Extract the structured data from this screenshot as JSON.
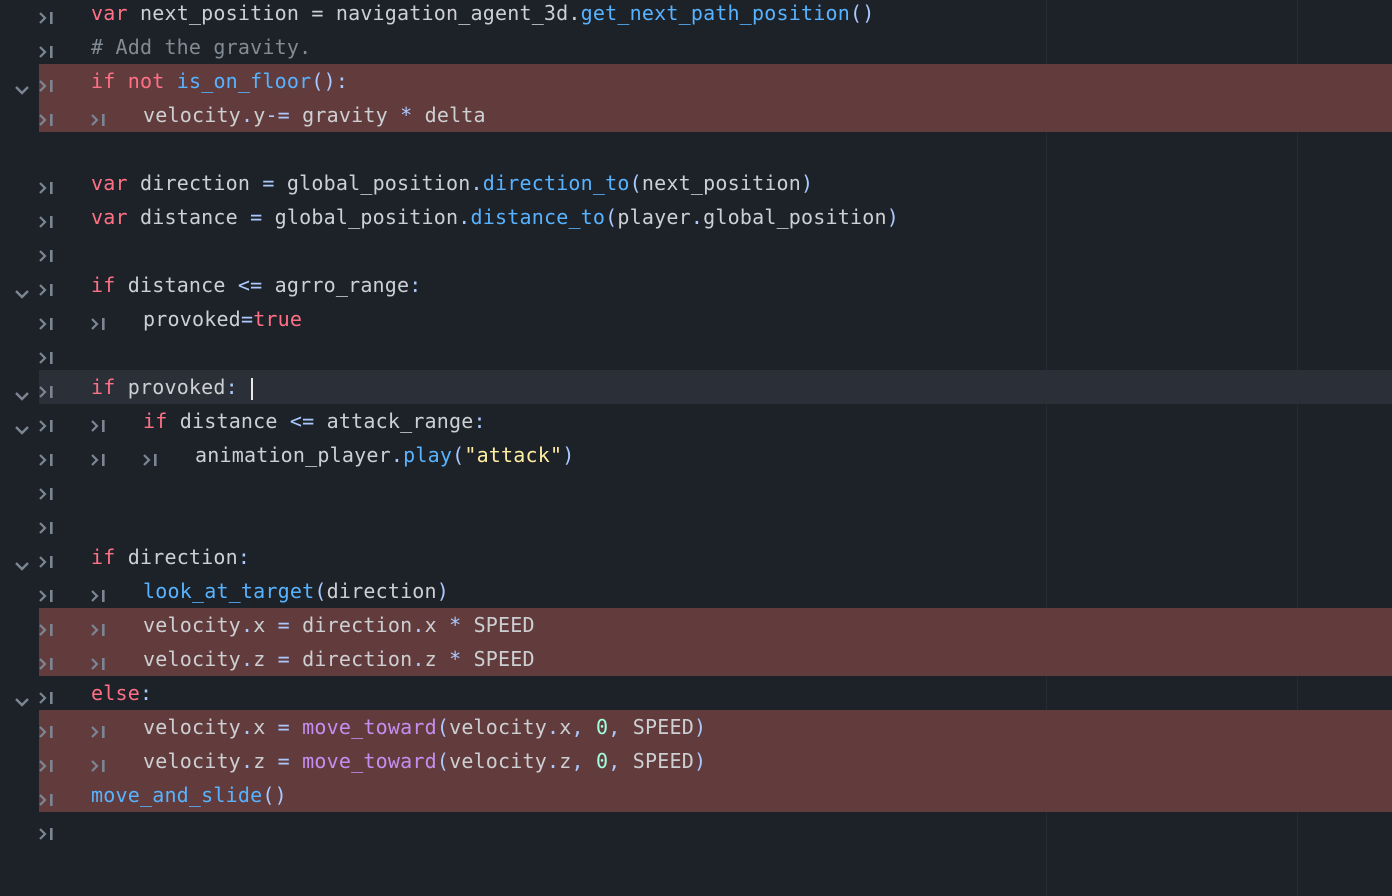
{
  "editor": {
    "colors": {
      "background": "#1d2229",
      "error_line": "#623c3d",
      "current_line": "#2a2f38",
      "keyword": "#ff7085",
      "function": "#57b3ff",
      "builtin_function": "#c38ef0",
      "operator": "#abc9ff",
      "string": "#ffeda1",
      "number": "#a1ffe0",
      "comment": "#828a94",
      "text": "#cdcfd2",
      "gutter_icon": "#7c8593"
    },
    "icons": {
      "fold": "chevron-down-icon",
      "tab": "tab-indent-icon"
    },
    "lines": [
      {
        "indent": 0,
        "fold": false,
        "hl": "",
        "tokens": [
          [
            "kw",
            "var"
          ],
          [
            "id",
            " next_position = navigation_agent_3d."
          ],
          [
            "fn",
            "get_next_path_position"
          ],
          [
            "op",
            "()"
          ]
        ]
      },
      {
        "indent": 0,
        "fold": false,
        "hl": "",
        "tokens": [
          [
            "cm",
            "# Add the gravity."
          ]
        ]
      },
      {
        "indent": 0,
        "fold": true,
        "hl": "error",
        "tokens": [
          [
            "kw",
            "if"
          ],
          [
            "id",
            " "
          ],
          [
            "kw",
            "not"
          ],
          [
            "id",
            " "
          ],
          [
            "fn",
            "is_on_floor"
          ],
          [
            "op",
            "():"
          ]
        ]
      },
      {
        "indent": 1,
        "fold": false,
        "hl": "error",
        "tokens": [
          [
            "id",
            "velocity"
          ],
          [
            "op",
            "."
          ],
          [
            "id",
            "y"
          ],
          [
            "op",
            "-="
          ],
          [
            "id",
            " gravity "
          ],
          [
            "op",
            "*"
          ],
          [
            "id",
            " delta"
          ]
        ]
      },
      {
        "indent": -1,
        "fold": false,
        "hl": "",
        "tokens": []
      },
      {
        "indent": 0,
        "fold": false,
        "hl": "",
        "tokens": [
          [
            "kw",
            "var"
          ],
          [
            "id",
            " direction "
          ],
          [
            "op",
            "="
          ],
          [
            "id",
            " global_position"
          ],
          [
            "op",
            "."
          ],
          [
            "fn",
            "direction_to"
          ],
          [
            "op",
            "("
          ],
          [
            "id",
            "next_position"
          ],
          [
            "op",
            ")"
          ]
        ]
      },
      {
        "indent": 0,
        "fold": false,
        "hl": "",
        "tokens": [
          [
            "kw",
            "var"
          ],
          [
            "id",
            " distance "
          ],
          [
            "op",
            "="
          ],
          [
            "id",
            " global_position"
          ],
          [
            "op",
            "."
          ],
          [
            "fn",
            "distance_to"
          ],
          [
            "op",
            "("
          ],
          [
            "id",
            "player"
          ],
          [
            "op",
            "."
          ],
          [
            "id",
            "global_position"
          ],
          [
            "op",
            ")"
          ]
        ]
      },
      {
        "indent": 0,
        "fold": false,
        "hl": "",
        "tokens": []
      },
      {
        "indent": 0,
        "fold": true,
        "hl": "",
        "tokens": [
          [
            "kw",
            "if"
          ],
          [
            "id",
            " distance "
          ],
          [
            "op",
            "<="
          ],
          [
            "id",
            " agrro_range"
          ],
          [
            "op",
            ":"
          ]
        ]
      },
      {
        "indent": 1,
        "fold": false,
        "hl": "",
        "tokens": [
          [
            "id",
            "provoked"
          ],
          [
            "op",
            "="
          ],
          [
            "kw",
            "true"
          ]
        ]
      },
      {
        "indent": 0,
        "fold": false,
        "hl": "",
        "tokens": []
      },
      {
        "indent": 0,
        "fold": true,
        "hl": "current",
        "caret": true,
        "tokens": [
          [
            "kw",
            "if"
          ],
          [
            "id",
            " provoked"
          ],
          [
            "op",
            ":"
          ],
          [
            "id",
            " "
          ]
        ]
      },
      {
        "indent": 1,
        "fold": true,
        "hl": "",
        "tokens": [
          [
            "kw",
            "if"
          ],
          [
            "id",
            " distance "
          ],
          [
            "op",
            "<="
          ],
          [
            "id",
            " attack_range"
          ],
          [
            "op",
            ":"
          ]
        ]
      },
      {
        "indent": 2,
        "fold": false,
        "hl": "",
        "tokens": [
          [
            "id",
            "animation_player"
          ],
          [
            "op",
            "."
          ],
          [
            "fn",
            "play"
          ],
          [
            "op",
            "("
          ],
          [
            "str",
            "\"attack\""
          ],
          [
            "op",
            ")"
          ]
        ]
      },
      {
        "indent": 0,
        "fold": false,
        "hl": "",
        "tokens": []
      },
      {
        "indent": 0,
        "fold": false,
        "hl": "",
        "tokens": []
      },
      {
        "indent": 0,
        "fold": true,
        "hl": "",
        "tokens": [
          [
            "kw",
            "if"
          ],
          [
            "id",
            " direction"
          ],
          [
            "op",
            ":"
          ]
        ]
      },
      {
        "indent": 1,
        "fold": false,
        "hl": "",
        "tokens": [
          [
            "fn",
            "look_at_target"
          ],
          [
            "op",
            "("
          ],
          [
            "id",
            "direction"
          ],
          [
            "op",
            ")"
          ]
        ]
      },
      {
        "indent": 1,
        "fold": false,
        "hl": "error",
        "tokens": [
          [
            "id",
            "velocity"
          ],
          [
            "op",
            "."
          ],
          [
            "id",
            "x "
          ],
          [
            "op",
            "="
          ],
          [
            "id",
            " direction"
          ],
          [
            "op",
            "."
          ],
          [
            "id",
            "x "
          ],
          [
            "op",
            "*"
          ],
          [
            "id",
            " SPEED"
          ]
        ]
      },
      {
        "indent": 1,
        "fold": false,
        "hl": "error",
        "tokens": [
          [
            "id",
            "velocity"
          ],
          [
            "op",
            "."
          ],
          [
            "id",
            "z "
          ],
          [
            "op",
            "="
          ],
          [
            "id",
            " direction"
          ],
          [
            "op",
            "."
          ],
          [
            "id",
            "z "
          ],
          [
            "op",
            "*"
          ],
          [
            "id",
            " SPEED"
          ]
        ]
      },
      {
        "indent": 0,
        "fold": true,
        "hl": "",
        "tokens": [
          [
            "kw",
            "else"
          ],
          [
            "op",
            ":"
          ]
        ]
      },
      {
        "indent": 1,
        "fold": false,
        "hl": "error",
        "tokens": [
          [
            "id",
            "velocity"
          ],
          [
            "op",
            "."
          ],
          [
            "id",
            "x "
          ],
          [
            "op",
            "="
          ],
          [
            "id",
            " "
          ],
          [
            "cl",
            "move_toward"
          ],
          [
            "op",
            "("
          ],
          [
            "id",
            "velocity"
          ],
          [
            "op",
            "."
          ],
          [
            "id",
            "x"
          ],
          [
            "op",
            ","
          ],
          [
            "id",
            " "
          ],
          [
            "num",
            "0"
          ],
          [
            "op",
            ","
          ],
          [
            "id",
            " SPEED"
          ],
          [
            "op",
            ")"
          ]
        ]
      },
      {
        "indent": 1,
        "fold": false,
        "hl": "error",
        "tokens": [
          [
            "id",
            "velocity"
          ],
          [
            "op",
            "."
          ],
          [
            "id",
            "z "
          ],
          [
            "op",
            "="
          ],
          [
            "id",
            " "
          ],
          [
            "cl",
            "move_toward"
          ],
          [
            "op",
            "("
          ],
          [
            "id",
            "velocity"
          ],
          [
            "op",
            "."
          ],
          [
            "id",
            "z"
          ],
          [
            "op",
            ","
          ],
          [
            "id",
            " "
          ],
          [
            "num",
            "0"
          ],
          [
            "op",
            ","
          ],
          [
            "id",
            " SPEED"
          ],
          [
            "op",
            ")"
          ]
        ]
      },
      {
        "indent": 0,
        "fold": false,
        "hl": "error",
        "tokens": [
          [
            "fn",
            "move_and_slide"
          ],
          [
            "op",
            "()"
          ]
        ]
      },
      {
        "indent": 0,
        "fold": false,
        "hl": "",
        "tokens": []
      }
    ]
  }
}
